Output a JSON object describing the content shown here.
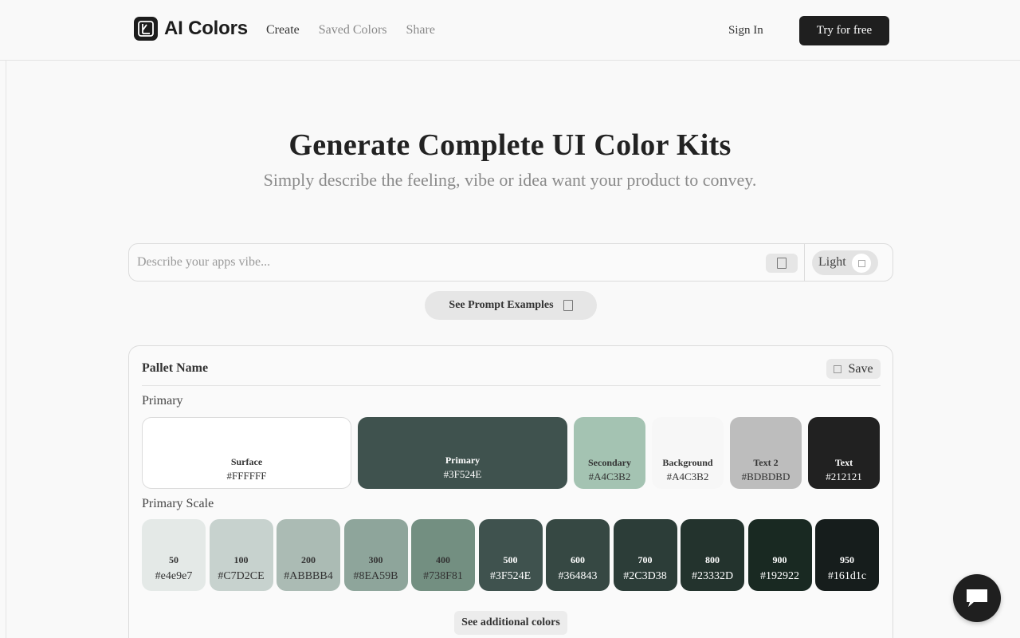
{
  "header": {
    "brand": "AI Colors",
    "nav": [
      {
        "label": "Create",
        "active": true
      },
      {
        "label": "Saved Colors",
        "active": false
      },
      {
        "label": "Share",
        "active": false
      }
    ],
    "sign_in": "Sign In",
    "cta": "Try for free"
  },
  "hero": {
    "title": "Generate Complete UI Color Kits",
    "subtitle": "Simply describe the feeling, vibe or idea want your product to convey."
  },
  "search": {
    "placeholder": "Describe your apps vibe...",
    "value": "",
    "theme_label": "Light"
  },
  "examples_button": "See Prompt Examples",
  "palette": {
    "name": "Pallet Name",
    "save_label": "Save",
    "primary_label": "Primary",
    "scale_label": "Primary Scale",
    "additional_button": "See additional colors",
    "main_colors": [
      {
        "name": "Surface",
        "hex": "#FFFFFF",
        "bg": "#FFFFFF",
        "fg": "#333333"
      },
      {
        "name": "Primary",
        "hex": "#3F524E",
        "bg": "#3F524E",
        "fg": "#FFFFFF"
      },
      {
        "name": "Secondary",
        "hex": "#A4C3B2",
        "bg": "#A4C3B2",
        "fg": "#333333"
      },
      {
        "name": "Background",
        "hex": "#A4C3B2",
        "bg": "#F7F7F7",
        "fg": "#333333"
      },
      {
        "name": "Text 2",
        "hex": "#BDBDBD",
        "bg": "#BDBDBD",
        "fg": "#333333"
      },
      {
        "name": "Text",
        "hex": "#212121",
        "bg": "#212121",
        "fg": "#FFFFFF"
      }
    ],
    "scale": [
      {
        "name": "50",
        "hex": "#e4e9e7",
        "bg": "#e4e9e7",
        "fg": "#333333"
      },
      {
        "name": "100",
        "hex": "#C7D2CE",
        "bg": "#C7D2CE",
        "fg": "#333333"
      },
      {
        "name": "200",
        "hex": "#ABBBB4",
        "bg": "#ABBBB4",
        "fg": "#333333"
      },
      {
        "name": "300",
        "hex": "#8EA59B",
        "bg": "#8EA59B",
        "fg": "#333333"
      },
      {
        "name": "400",
        "hex": "#738F81",
        "bg": "#738F81",
        "fg": "#333333"
      },
      {
        "name": "500",
        "hex": "#3F524E",
        "bg": "#3F524E",
        "fg": "#FFFFFF"
      },
      {
        "name": "600",
        "hex": "#364843",
        "bg": "#364843",
        "fg": "#FFFFFF"
      },
      {
        "name": "700",
        "hex": "#2C3D38",
        "bg": "#2C3D38",
        "fg": "#FFFFFF"
      },
      {
        "name": "800",
        "hex": "#23332D",
        "bg": "#23332D",
        "fg": "#FFFFFF"
      },
      {
        "name": "900",
        "hex": "#192922",
        "bg": "#192922",
        "fg": "#FFFFFF"
      },
      {
        "name": "950",
        "hex": "#161d1c",
        "bg": "#161d1c",
        "fg": "#FFFFFF"
      }
    ]
  }
}
